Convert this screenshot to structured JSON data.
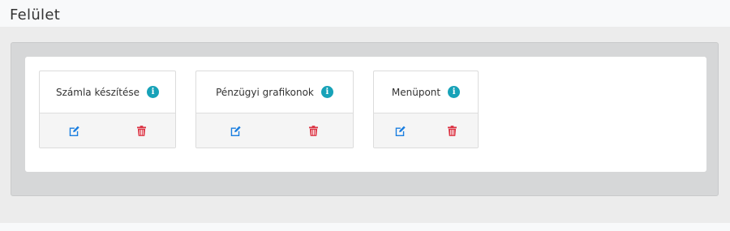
{
  "page": {
    "title": "Felület"
  },
  "colors": {
    "info": "#17a2b8",
    "edit": "#1a7ee0",
    "delete": "#dc3545"
  },
  "cards": [
    {
      "label": "Számla készítése",
      "info_icon": "info-circle-icon",
      "edit_icon": "edit-icon",
      "delete_icon": "trash-icon"
    },
    {
      "label": "Pénzügyi grafikonok",
      "info_icon": "info-circle-icon",
      "edit_icon": "edit-icon",
      "delete_icon": "trash-icon"
    },
    {
      "label": "Menüpont",
      "info_icon": "info-circle-icon",
      "edit_icon": "edit-icon",
      "delete_icon": "trash-icon"
    }
  ]
}
